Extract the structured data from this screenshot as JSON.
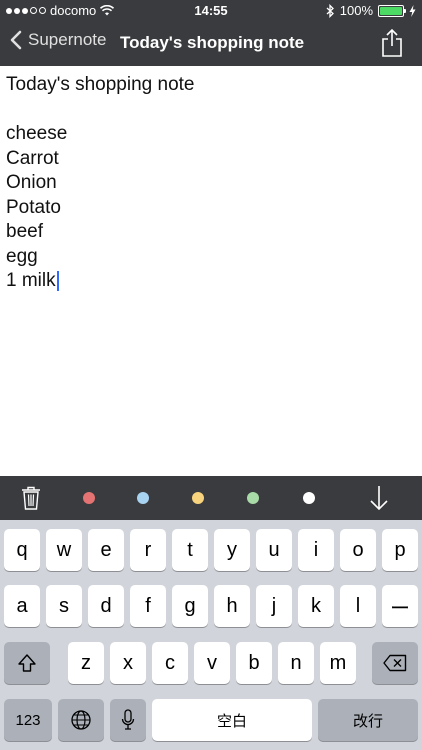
{
  "status_bar": {
    "carrier": "docomo",
    "time": "14:55",
    "battery": "100%"
  },
  "nav": {
    "back_label": "Supernote",
    "title": "Today's shopping note"
  },
  "note": {
    "lines": [
      "Today's shopping note",
      "",
      "cheese",
      "Carrot",
      "Onion",
      "Potato",
      "beef",
      "egg",
      "1 milk"
    ]
  },
  "toolbar": {
    "colors": [
      "#e57373",
      "#a7d3f1",
      "#f6d37c",
      "#a8dba8",
      "#ffffff"
    ]
  },
  "keyboard": {
    "row1": [
      "q",
      "w",
      "e",
      "r",
      "t",
      "y",
      "u",
      "i",
      "o",
      "p"
    ],
    "row2": [
      "a",
      "s",
      "d",
      "f",
      "g",
      "h",
      "j",
      "k",
      "l",
      "ー"
    ],
    "row3": [
      "z",
      "x",
      "c",
      "v",
      "b",
      "n",
      "m"
    ],
    "numbers_key": "123",
    "space_key": "空白",
    "return_key": "改行"
  }
}
